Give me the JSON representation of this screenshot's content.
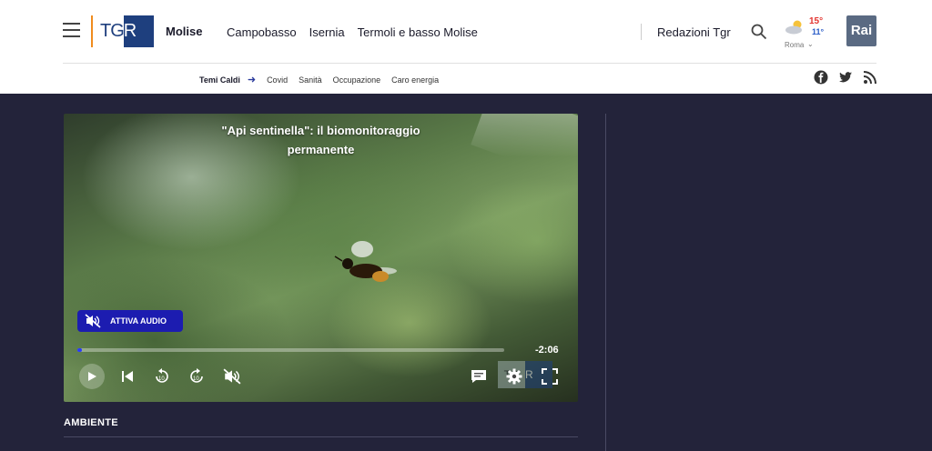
{
  "header": {
    "logo": {
      "tg": "TG",
      "r": "R"
    },
    "region": "Molise",
    "nav": [
      "Campobasso",
      "Isernia",
      "Termoli e basso Molise"
    ],
    "redazioni": "Redazioni Tgr",
    "weather": {
      "max": "15°",
      "min": "11°",
      "city": "Roma"
    },
    "rai_logo": "Rai"
  },
  "topics": {
    "label": "Temi Caldi",
    "items": [
      "Covid",
      "Sanità",
      "Occupazione",
      "Caro energia"
    ]
  },
  "social": [
    "facebook-icon",
    "twitter-icon",
    "rss-icon"
  ],
  "player": {
    "title": "\"Api sentinella\": il biomonitoraggio permanente",
    "audio_label": "ATTIVA AUDIO",
    "time_remaining": "-2:06",
    "progress": 0.01,
    "watermark": {
      "a": "TG",
      "b": "R"
    }
  },
  "section": "AMBIENTE",
  "colors": {
    "brand": "#1e3f7e",
    "accent": "#f08c1e",
    "page_bg": "#23233a",
    "audio_btn": "#1c1cb0"
  }
}
